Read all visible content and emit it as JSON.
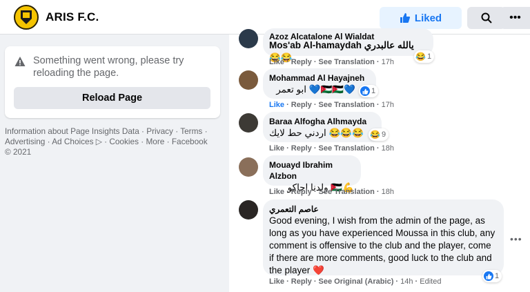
{
  "header": {
    "page_name": "ARIS F.C.",
    "liked_label": "Liked",
    "colors": {
      "accent": "#1877f2",
      "liked_bg": "#e7f3ff"
    }
  },
  "error_card": {
    "message": "Something went wrong, please try reloading the page.",
    "reload_label": "Reload Page"
  },
  "footer": {
    "text": "Information about Page Insights Data · Privacy · Terms · Advertising · Ad Choices ▷ · Cookies · More · Facebook © 2021"
  },
  "comments": [
    {
      "author": "Azoz Alcatalone Al Wialdat",
      "body": "Mos'ab Al-hamaydah يالله عالبدري 😂😂",
      "actions": {
        "like": "Like",
        "reply": "Reply",
        "translate": "See Translation",
        "time": "17h"
      },
      "reaction_emoji": "😂",
      "reaction_count": "1"
    },
    {
      "author": "Mohammad Al Hayajneh",
      "body": "ابو تعمر 💙🇯🇴🇯🇴💙",
      "actions": {
        "like": "Like",
        "reply": "Reply",
        "translate": "See Translation",
        "time": "17h"
      },
      "reaction_count": "1"
    },
    {
      "author": "Baraa Alfogha Alhmayda",
      "body": "اردني حط لايك 😂😂😂",
      "actions": {
        "like": "Like",
        "reply": "Reply",
        "translate": "See Translation",
        "time": "18h"
      },
      "reaction_emoji": "😂",
      "reaction_count": "9"
    },
    {
      "author": "Mouayd Ibrahim Alzbon",
      "body": "ولدنا اجاكو 🇯🇴💪",
      "actions": {
        "like": "Like",
        "reply": "Reply",
        "translate": "See Translation",
        "time": "18h"
      }
    },
    {
      "author": "عاصم التعمري",
      "body": "Good evening, I wish from the admin of the page, as long as you have experienced Moussa in this club, any comment is offensive to the club and the player, come if there are more comments, good luck to the club and the player ❤️",
      "actions": {
        "like": "Like",
        "reply": "Reply",
        "original": "See Original (Arabic)",
        "time": "14h",
        "edited": "Edited"
      },
      "reaction_count": "1"
    }
  ]
}
